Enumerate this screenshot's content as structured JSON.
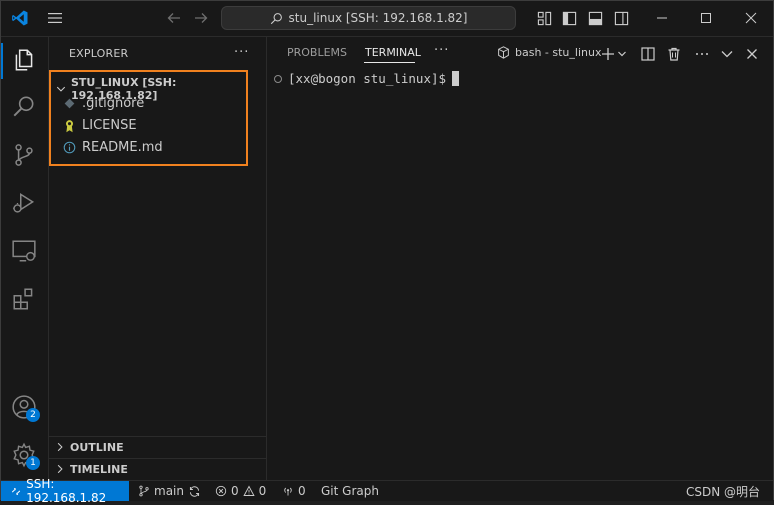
{
  "titlebar": {
    "search_text": "stu_linux [SSH: 192.168.1.82]"
  },
  "sidebar": {
    "title": "EXPLORER",
    "more": "···",
    "folder_name": "STU_LINUX [SSH: 192.168.1.82]",
    "files": [
      {
        "name": ".gitignore",
        "icon": "diamond-icon"
      },
      {
        "name": "LICENSE",
        "icon": "license-icon"
      },
      {
        "name": "README.md",
        "icon": "info-icon"
      }
    ],
    "outline": "OUTLINE",
    "timeline": "TIMELINE"
  },
  "activity": {
    "accounts_badge": "2",
    "manage_badge": "1"
  },
  "panel": {
    "tabs": [
      "PROBLEMS",
      "TERMINAL"
    ],
    "active_tab": "TERMINAL",
    "more": "···",
    "terminal_name": "bash - stu_linux",
    "prompt": "[xx@bogon stu_linux]$"
  },
  "statusbar": {
    "remote": "SSH: 192.168.1.82",
    "branch": "main",
    "errors": "0",
    "warnings": "0",
    "ports": "0",
    "git_graph": "Git Graph",
    "watermark": "CSDN @明台"
  },
  "colors": {
    "accent": "#0078d4",
    "highlight_box": "#f0811f",
    "background": "#181818"
  }
}
